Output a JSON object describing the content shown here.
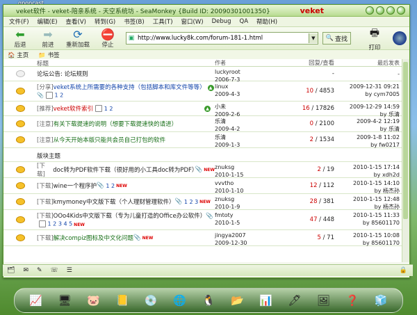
{
  "desktop": {
    "label": "gpopcast"
  },
  "window": {
    "title": "veket软件 - veket-陪亲系统 - 天空系统坊 - SeaMonkey {Build ID: 20090301001350}",
    "brand": "veket"
  },
  "menu": [
    "文件(F)",
    "编辑(E)",
    "查看(V)",
    "转到(G)",
    "书签(B)",
    "工具(T)",
    "窗口(W)",
    "Debug",
    "QA",
    "帮助(H)"
  ],
  "nav": {
    "back": "后退",
    "forward": "前进",
    "reload": "重新加载",
    "stop": "停止",
    "url": "http://www.lucky8k.com/forum-181-1.html",
    "search": "查找",
    "print": "打印"
  },
  "bookmarks": {
    "home": "主页",
    "bookmarks": "书签"
  },
  "table": {
    "headers": {
      "title": "标题",
      "author": "作者",
      "replies": "回复/查看",
      "last": "最后发表"
    }
  },
  "announcement": {
    "title": "论坛公告: 论坛规则",
    "author": "luckyroot",
    "date": "2006-7-3",
    "replies": "-",
    "last": "-"
  },
  "pinned": [
    {
      "tag": "[分享]",
      "title": "veket系统上所需要的各种支持（包括脚本和库文件等等）",
      "pages": "1 2",
      "author": "linux",
      "date": "2009-4-3",
      "rep": "10",
      "views": "4853",
      "last_date": "2009-12-31 09:21",
      "last_by": "by cym7005"
    },
    {
      "tag": "[推荐]",
      "title": "veket软件索引",
      "pages": "1 2",
      "author": "小未",
      "date": "2009-2-6",
      "rep": "16",
      "views": "17826",
      "last_date": "2009-12-29 14:59",
      "last_by": "by 乐清"
    },
    {
      "tag": "[注意]",
      "title": "有关下载提速的说明（想要下载提速快的请进）",
      "pages": "",
      "author": "乐清",
      "date": "2009-4-2",
      "rep": "0",
      "views": "2100",
      "last_date": "2009-4-2 12:19",
      "last_by": "by 乐清"
    },
    {
      "tag": "[注意]",
      "title": "从今天开始本版只能共会员自己打包的软件",
      "pages": "",
      "author": "乐清",
      "date": "2009-1-3",
      "rep": "2",
      "views": "1534",
      "last_date": "2009-1-8 11:02",
      "last_by": "by fw0217"
    }
  ],
  "section_label": "版块主题",
  "threads": [
    {
      "tag": "[下载]",
      "title": "doc转为PDF软件下载（很好用的小工具doc转为PDF）",
      "pages": "",
      "new": "NEW",
      "author": "znuksg",
      "date": "2010-1-15",
      "rep": "2",
      "views": "19",
      "last_date": "2010-1-15 17:14",
      "last_by": "by xdh2d"
    },
    {
      "tag": "[下载]",
      "title": "wine一个程序护",
      "pages": "1 2",
      "new": "NEW",
      "author": "vvvtho",
      "date": "2010-1-10",
      "rep": "12",
      "views": "112",
      "last_date": "2010-1-15 14:10",
      "last_by": "by 杨杰孙"
    },
    {
      "tag": "[下载]",
      "title": "kmymoney中文版下载（个人理财管理软件）",
      "pages": "1 2 3",
      "new": "NEW",
      "author": "znuksg",
      "date": "2010-1-9",
      "rep": "28",
      "views": "381",
      "last_date": "2010-1-15 12:48",
      "last_by": "by 杨杰孙"
    },
    {
      "tag": "[下载]",
      "title": "OOo4Kids中文版下载（专为儿童打造的Office办公软件）",
      "pages": "1 2 3 4 5",
      "new": "NEW",
      "author": "fmtoty",
      "date": "2010-1-5",
      "rep": "47",
      "views": "448",
      "last_date": "2010-1-15 11:33",
      "last_by": "by 85601170"
    },
    {
      "tag": "[下载]",
      "title": "解决compiz图标及中文化问题",
      "pages": "",
      "new": "NEW",
      "author": "jingya2007",
      "date": "2009-12-30",
      "rep": "5",
      "views": "71",
      "last_date": "2010-1-15 10:08",
      "last_by": "by 85601170"
    }
  ],
  "colors": {
    "accent": "#5a9a2a",
    "link_red": "#cc0000",
    "link_blue": "#1144aa",
    "link_green": "#186f18"
  }
}
